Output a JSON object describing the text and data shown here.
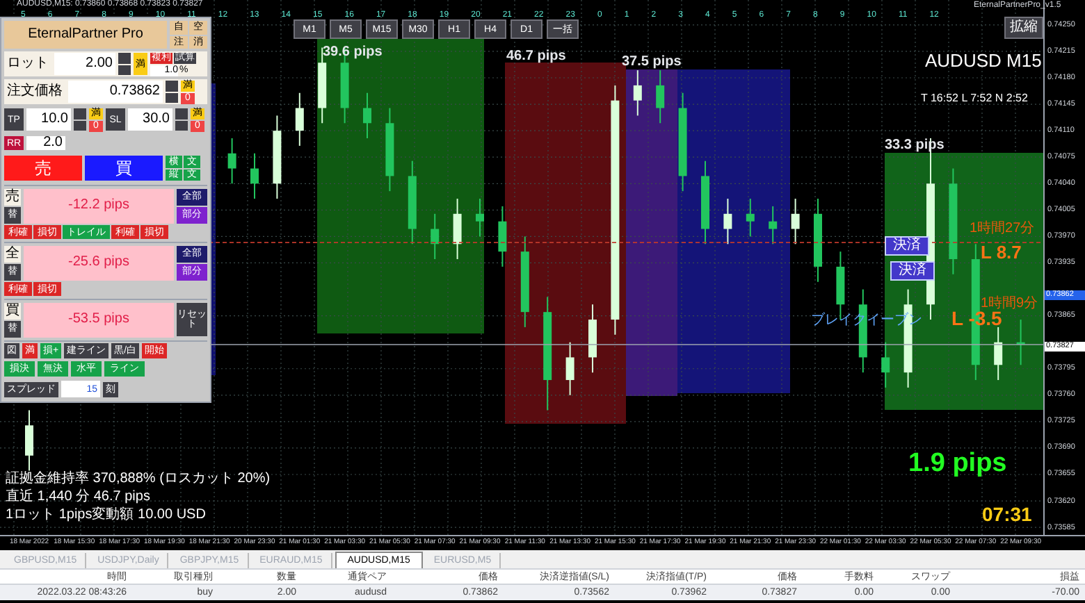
{
  "window": {
    "title": "AUDUSD,M15: 0.73860 0.73868 0.73823 0.73827",
    "indicator_name": "EternalPartnerPro_v1.5"
  },
  "hour_labels": [
    "5",
    "6",
    "7",
    "8",
    "9",
    "10",
    "11",
    "12",
    "13",
    "14",
    "15",
    "16",
    "17",
    "18",
    "19",
    "20",
    "21",
    "22",
    "23",
    "0",
    "1",
    "2",
    "3",
    "4",
    "5",
    "6",
    "7",
    "8",
    "9",
    "10",
    "11",
    "12"
  ],
  "timeframes": [
    {
      "label": "M1"
    },
    {
      "label": "M5"
    },
    {
      "label": "M15"
    },
    {
      "label": "M30"
    },
    {
      "label": "H1"
    },
    {
      "label": "H4"
    },
    {
      "label": "D1"
    },
    {
      "label": "一括"
    }
  ],
  "zoom_button": "拡縮",
  "symbol_label": "AUDUSD M15",
  "timer_line": "T 16:52  L 7:52  N 2:52",
  "chart": {
    "chart_data": {
      "type": "candlestick",
      "grid": true,
      "categories": [
        "18 Mar 2022",
        null,
        "18 Mar 15:30",
        null,
        "18 Mar 17:30",
        null,
        "18 Mar 19:30",
        null,
        "18 Mar 21:30",
        null,
        "20 Mar 23:30",
        null,
        "21 Mar 01:30",
        null,
        "21 Mar 03:30",
        null,
        "21 Mar 05:30",
        null,
        "21 Mar 07:30",
        null,
        "21 Mar 09:30",
        null,
        "21 Mar 11:30",
        null,
        "21 Mar 13:30",
        null,
        "21 Mar 15:30",
        null,
        "21 Mar 17:30",
        null,
        "21 Mar 19:30",
        null,
        "21 Mar 21:30",
        null,
        "21 Mar 23:30",
        null,
        "22 Mar 01:30",
        null,
        "22 Mar 03:30",
        null,
        "22 Mar 05:30",
        null,
        "22 Mar 07:30",
        null,
        "22 Mar 09:30"
      ],
      "ohlc": [
        [
          0.7368,
          0.7374,
          0.7366,
          0.7372
        ],
        null,
        null,
        null,
        null,
        null,
        null,
        null,
        null,
        [
          0.7408,
          0.741,
          0.7404,
          0.7406
        ],
        [
          0.7406,
          0.7408,
          0.7402,
          0.7404
        ],
        [
          0.7404,
          0.7413,
          0.7402,
          0.7411
        ],
        [
          0.7411,
          0.7416,
          0.7409,
          0.7414
        ],
        [
          0.7414,
          0.7422,
          0.7412,
          0.742
        ],
        [
          0.742,
          0.7422,
          0.7412,
          0.7414
        ],
        [
          0.7414,
          0.7416,
          0.741,
          0.7412
        ],
        [
          0.7412,
          0.7414,
          0.7403,
          0.7405
        ],
        [
          0.7405,
          0.7407,
          0.7396,
          0.7398
        ],
        [
          0.7398,
          0.74,
          0.7394,
          0.7396
        ],
        [
          0.7396,
          0.7402,
          0.7394,
          0.74
        ],
        [
          0.74,
          0.7402,
          0.7397,
          0.7399
        ],
        [
          0.7399,
          0.7401,
          0.7393,
          0.7395
        ],
        [
          0.7395,
          0.7397,
          0.7385,
          0.7387
        ],
        [
          0.7387,
          0.7389,
          0.7374,
          0.7378
        ],
        [
          0.7378,
          0.7383,
          0.7376,
          0.7381
        ],
        [
          0.7381,
          0.7388,
          0.7379,
          0.7386
        ],
        [
          0.7386,
          0.7417,
          0.7384,
          0.7415
        ],
        [
          0.7415,
          0.7419,
          0.7413,
          0.7417
        ],
        [
          0.7417,
          0.7419,
          0.7412,
          0.7414
        ],
        [
          0.7414,
          0.7416,
          0.7403,
          0.7405
        ],
        [
          0.7405,
          0.7407,
          0.7396,
          0.7398
        ],
        [
          0.7398,
          0.7402,
          0.7396,
          0.74
        ],
        [
          0.74,
          0.7402,
          0.7397,
          0.7399
        ],
        [
          0.7399,
          0.7401,
          0.7396,
          0.7398
        ],
        [
          0.7398,
          0.7402,
          0.7396,
          0.74
        ],
        [
          0.74,
          0.7402,
          0.7391,
          0.7393
        ],
        [
          0.7393,
          0.7395,
          0.7386,
          0.7388
        ],
        [
          0.7388,
          0.739,
          0.7379,
          0.7381
        ],
        [
          0.7381,
          0.7383,
          0.7377,
          0.7379
        ],
        [
          0.7379,
          0.739,
          0.7377,
          0.7388
        ],
        [
          0.7388,
          0.741,
          0.7386,
          0.7404
        ],
        [
          0.7404,
          0.7406,
          0.7392,
          0.7394
        ],
        [
          0.7394,
          0.7396,
          0.7378,
          0.738
        ],
        [
          0.738,
          0.7385,
          0.7378,
          0.7383
        ],
        [
          0.7383,
          0.7386,
          0.738,
          0.73827
        ]
      ],
      "ylim": [
        0.73575,
        0.74283
      ],
      "ref_lines": [
        {
          "axis": "y",
          "value": 0.73962,
          "color": "#c0392b"
        },
        {
          "axis": "y",
          "value": 0.73827,
          "color": "#9ca3af"
        }
      ],
      "yticks": [
        {
          "value": 0.7425,
          "label": "0.74250"
        },
        {
          "value": 0.74215,
          "label": "0.74215"
        },
        {
          "value": 0.7418,
          "label": "0.74180"
        },
        {
          "value": 0.74145,
          "label": "0.74145"
        },
        {
          "value": 0.7411,
          "label": "0.74110"
        },
        {
          "value": 0.74075,
          "label": "0.74075"
        },
        {
          "value": 0.7404,
          "label": "0.74040"
        },
        {
          "value": 0.74005,
          "label": "0.74005"
        },
        {
          "value": 0.7397,
          "label": "0.73970"
        },
        {
          "value": 0.73935,
          "label": "0.73935"
        },
        {
          "value": 0.73865,
          "label": "0.73865"
        },
        {
          "value": 0.73795,
          "label": "0.73795"
        },
        {
          "value": 0.7376,
          "label": "0.73760"
        },
        {
          "value": 0.73725,
          "label": "0.73725"
        },
        {
          "value": 0.7369,
          "label": "0.73690"
        },
        {
          "value": 0.73655,
          "label": "0.73655"
        },
        {
          "value": 0.7362,
          "label": "0.73620"
        },
        {
          "value": 0.73585,
          "label": "0.73585"
        }
      ]
    }
  },
  "zones": [
    {
      "color": "#101070"
    },
    {
      "label": "39.6 pips",
      "color": "#0f5a12"
    },
    {
      "label": "46.7 pips",
      "color": "#5a0c10"
    },
    {
      "label": "37.5 pips",
      "color": "#3c1a78"
    },
    {
      "color": "#141478"
    },
    {
      "label": "33.3 pips",
      "color": "#11641a"
    }
  ],
  "trade_marks": [
    {
      "close_button": "決済",
      "result": "L 8.7",
      "duration": "1時間27分"
    },
    {
      "close_button": "決済",
      "result": "L -3.5",
      "duration": "1時間9分"
    }
  ],
  "breakeven_label": "ブレイクイーブン",
  "big_pips": "1.9 pips",
  "countdown": "07:31",
  "info_lines": [
    "証拠金維持率 370,888% (ロスカット 20%)",
    "直近 1,440 分 46.7 pips",
    "1ロット 1pips変動額 10.00 USD"
  ],
  "price_tags": [
    {
      "kind": "entry",
      "text": "0.73862"
    },
    {
      "kind": "bid",
      "text": "0.73827"
    }
  ],
  "panel": {
    "title": "EternalPartner Pro",
    "title_buttons": [
      "自",
      "空",
      "注",
      "消"
    ],
    "lot": {
      "label": "ロット",
      "value": "2.00",
      "max": "満",
      "compound": "複利",
      "calc": "試算",
      "risk": "1.0",
      "unit": "%"
    },
    "order_price": {
      "label": "注文価格",
      "value": "0.73862",
      "max": "満",
      "zero": "0"
    },
    "tp": {
      "label": "TP",
      "value": "10.0",
      "max": "満",
      "zero": "0"
    },
    "sl": {
      "label": "SL",
      "value": "30.0",
      "max": "満",
      "zero": "0"
    },
    "rr": {
      "label": "RR",
      "value": "2.0"
    },
    "sell": "売",
    "buy": "買",
    "side_buttons": [
      "横",
      "文",
      "縦",
      "文"
    ],
    "sections": [
      {
        "tag": "売",
        "sub": "替",
        "pips": "-12.2 pips",
        "right": [
          "全部",
          "部分"
        ],
        "actions": [
          {
            "label": "利確",
            "kind": "red"
          },
          {
            "label": "損切",
            "kind": "red"
          },
          {
            "label": "トレイル",
            "kind": "green"
          },
          {
            "label": "利確",
            "kind": "red"
          },
          {
            "label": "損切",
            "kind": "red"
          }
        ]
      },
      {
        "tag": "全",
        "sub": "替",
        "pips": "-25.6 pips",
        "right": [
          "全部",
          "部分"
        ],
        "actions": [
          {
            "label": "利確",
            "kind": "red"
          },
          {
            "label": "損切",
            "kind": "red"
          }
        ]
      },
      {
        "tag": "買",
        "sub": "替",
        "pips": "-53.5 pips",
        "right": [
          "リセット"
        ]
      }
    ],
    "tools": [
      {
        "label": "図",
        "kind": "dark"
      },
      {
        "label": "満",
        "kind": "red"
      },
      {
        "label": "損+",
        "kind": "green"
      },
      {
        "label": "建ライン",
        "kind": "dark"
      },
      {
        "label": "黒/白",
        "kind": "dark"
      },
      {
        "label": "開始",
        "kind": "red"
      }
    ],
    "lines": [
      "損決",
      "無決",
      "水平",
      "ライン"
    ],
    "spread": {
      "label": "スプレッド",
      "value": "15",
      "unit": "刻"
    }
  },
  "tabs": [
    {
      "label": "GBPUSD,M15",
      "selected": false
    },
    {
      "label": "USDJPY,Daily",
      "selected": false
    },
    {
      "label": "GBPJPY,M15",
      "selected": false
    },
    {
      "label": "EURAUD,M15",
      "selected": false
    },
    {
      "label": "AUDUSD,M15",
      "selected": true
    },
    {
      "label": "EURUSD,M5",
      "selected": false
    }
  ],
  "table": {
    "columns": [
      "時間",
      "取引種別",
      "数量",
      "通貨ペア",
      "価格",
      "決済逆指値(S/L)",
      "決済指値(T/P)",
      "価格",
      "手数料",
      "スワップ",
      "損益"
    ],
    "rows": [
      [
        "2022.03.22 08:43:26",
        "buy",
        "2.00",
        "audusd",
        "0.73862",
        "0.73562",
        "0.73962",
        "0.73827",
        "0.00",
        "0.00",
        "-70.00"
      ]
    ]
  }
}
